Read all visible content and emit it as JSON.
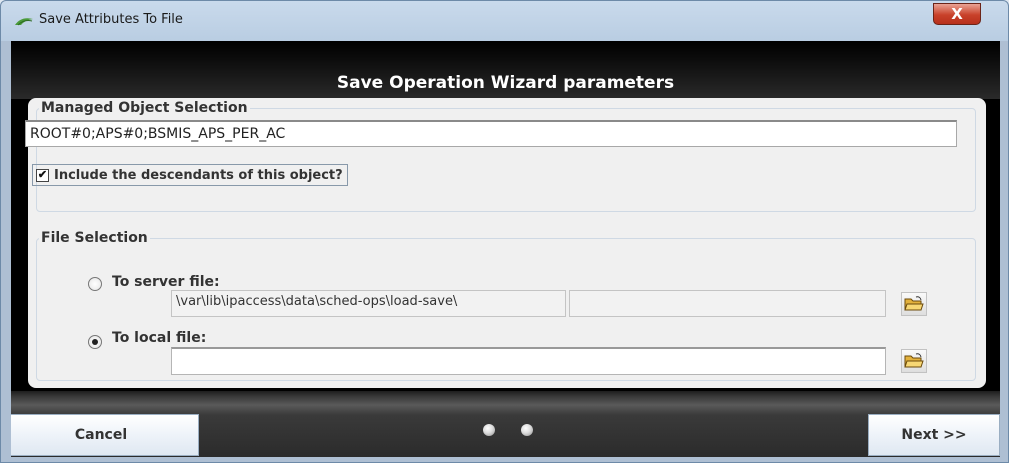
{
  "window": {
    "title": "Save Attributes To File",
    "close_glyph": "X",
    "icon": "app-leaf-icon"
  },
  "header": {
    "title": "Save Operation Wizard parameters"
  },
  "managed_object": {
    "legend": "Managed Object Selection",
    "value": "ROOT#0;APS#0;BSMIS_APS_PER_AC",
    "include_descendants": {
      "label": "Include the descendants of this object?",
      "checked": true,
      "glyph": "✔"
    }
  },
  "file_selection": {
    "legend": "File Selection",
    "server": {
      "label": "To server file:",
      "selected": false,
      "path": "\\var\\lib\\ipaccess\\data\\sched-ops\\load-save\\",
      "filename": ""
    },
    "local": {
      "label": "To local file:",
      "selected": true,
      "path": ""
    },
    "browse_icon": "open-folder-icon"
  },
  "footer": {
    "cancel_label": "Cancel",
    "next_label": "Next >>",
    "step_indicator": 2
  },
  "colors": {
    "close_button": "#c8412a",
    "header_bg": "#000000",
    "panel_bg": "#f0f0f0",
    "titlebar": "#c9daec"
  }
}
